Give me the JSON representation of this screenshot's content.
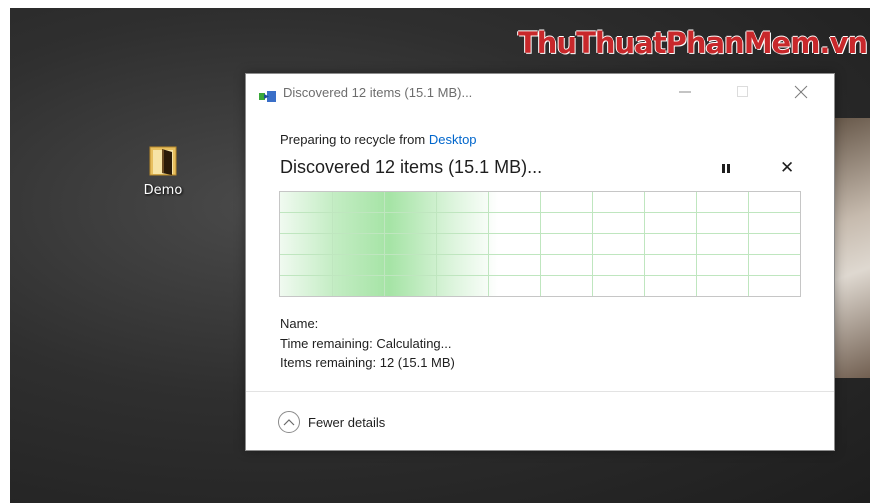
{
  "watermark": "ThuThuatPhanMem.vn",
  "desktop": {
    "icon_label": "Demo"
  },
  "dialog": {
    "title": "Discovered 12 items (15.1 MB)...",
    "subheading_prefix": "Preparing to recycle from ",
    "subheading_location": "Desktop",
    "heading": "Discovered 12 items (15.1 MB)...",
    "details": {
      "name_label": "Name:",
      "name_value": "",
      "time_label": "Time remaining:",
      "time_value": "Calculating...",
      "items_label": "Items remaining:",
      "items_value": "12 (15.1 MB)"
    },
    "fewer_details_label": "Fewer details",
    "colors": {
      "accent_link": "#0066cc",
      "graph_fill": "#a0e2a0"
    }
  }
}
